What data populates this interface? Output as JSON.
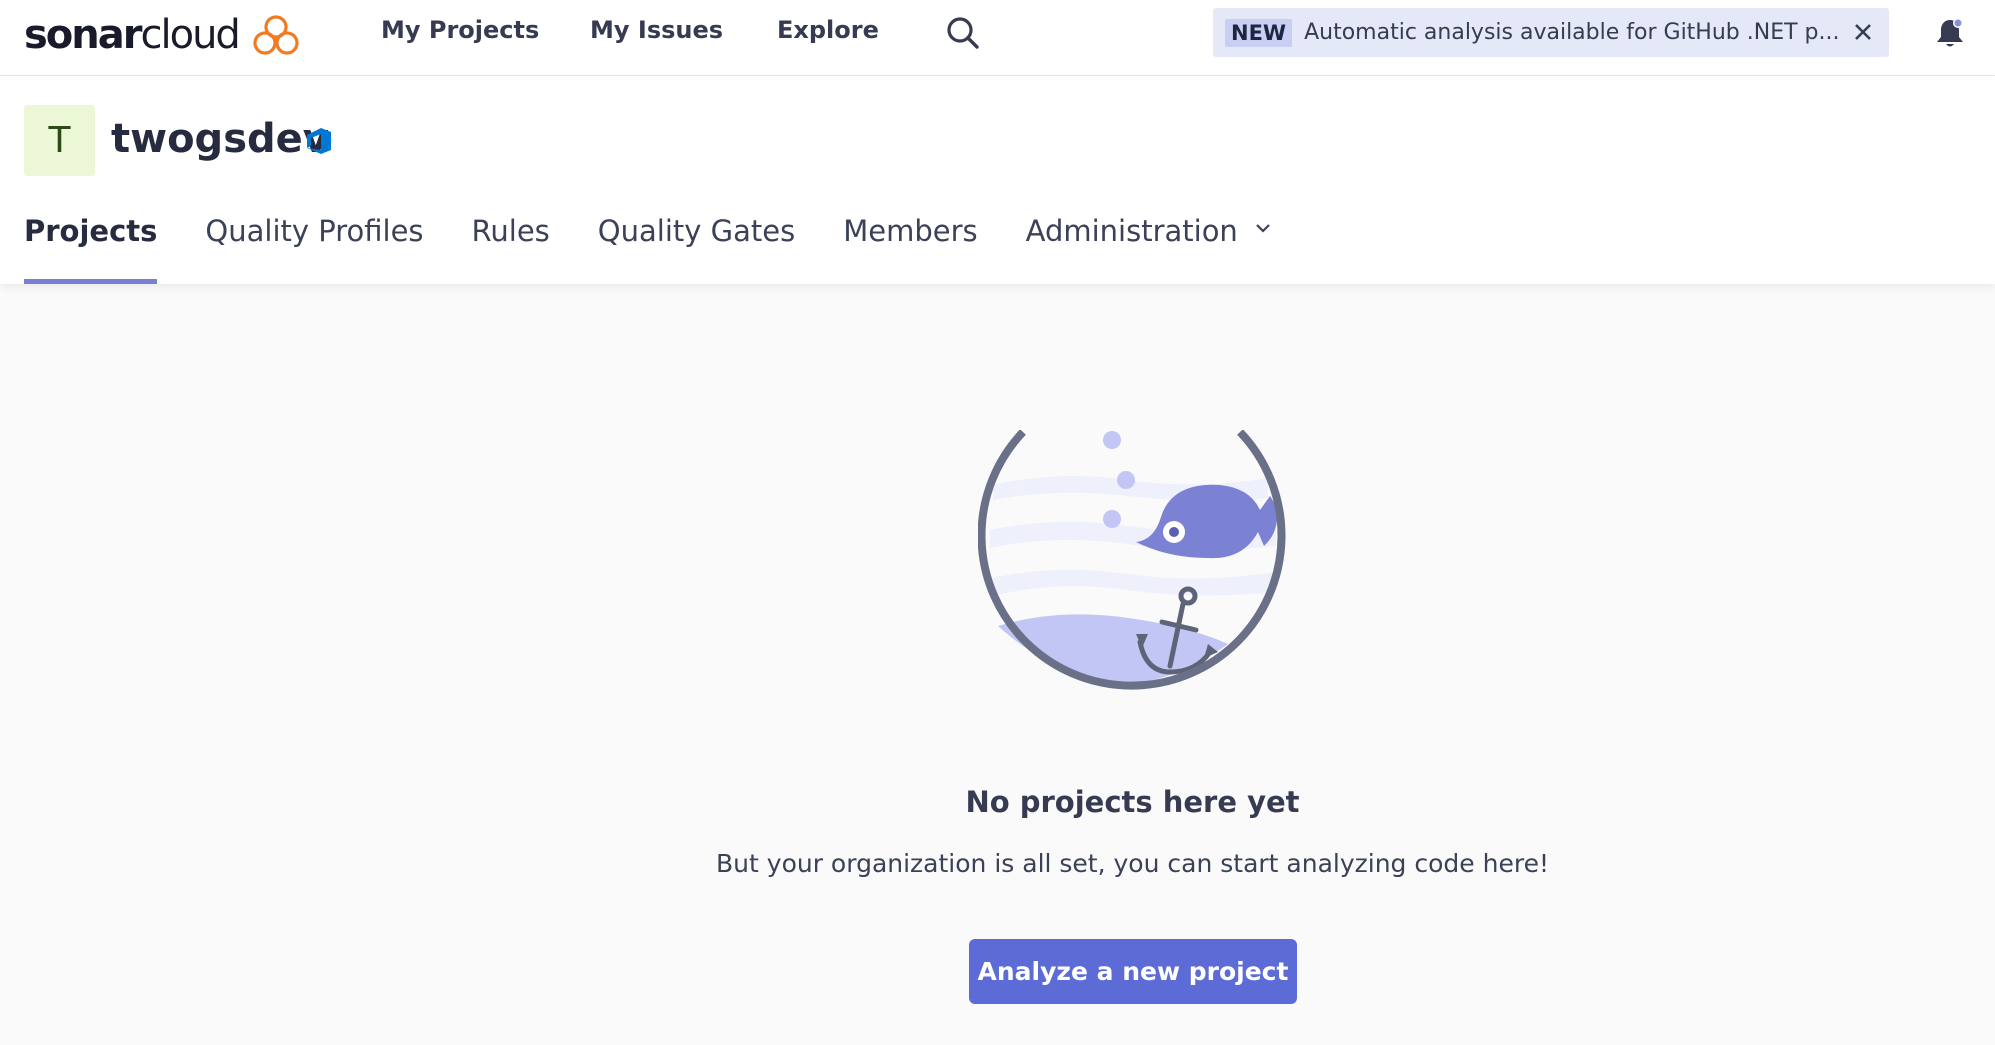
{
  "brand": {
    "name_bold": "sonar",
    "name_light": "cloud",
    "accent": "#f07b20",
    "logo_icon": "cloud-icon"
  },
  "topnav": {
    "my_projects": "My Projects",
    "my_issues": "My Issues",
    "explore": "Explore",
    "search_icon": "search-icon"
  },
  "promo": {
    "badge": "NEW",
    "message": "Automatic analysis available for GitHub .NET p...",
    "close_icon": "close-icon"
  },
  "notifications": {
    "icon": "bell-icon"
  },
  "org": {
    "avatar_letter": "T",
    "name": "twogsdev",
    "provider_icon": "azure-devops-icon"
  },
  "tabs": [
    {
      "label": "Projects",
      "active": true
    },
    {
      "label": "Quality Profiles",
      "active": false
    },
    {
      "label": "Rules",
      "active": false
    },
    {
      "label": "Quality Gates",
      "active": false
    },
    {
      "label": "Members",
      "active": false
    },
    {
      "label": "Administration",
      "active": false,
      "has_dropdown": true
    }
  ],
  "empty_state": {
    "illustration": "fishbowl-anchor-illustration",
    "title": "No projects here yet",
    "text": "But your organization is all set, you can start analyzing code here!",
    "button": "Analyze a new project"
  },
  "colors": {
    "primary": "#5d6bd6",
    "tab_underline": "#7b7fd4",
    "avatar_bg": "#ecf7d7",
    "promo_bg": "#e5e8f7"
  }
}
